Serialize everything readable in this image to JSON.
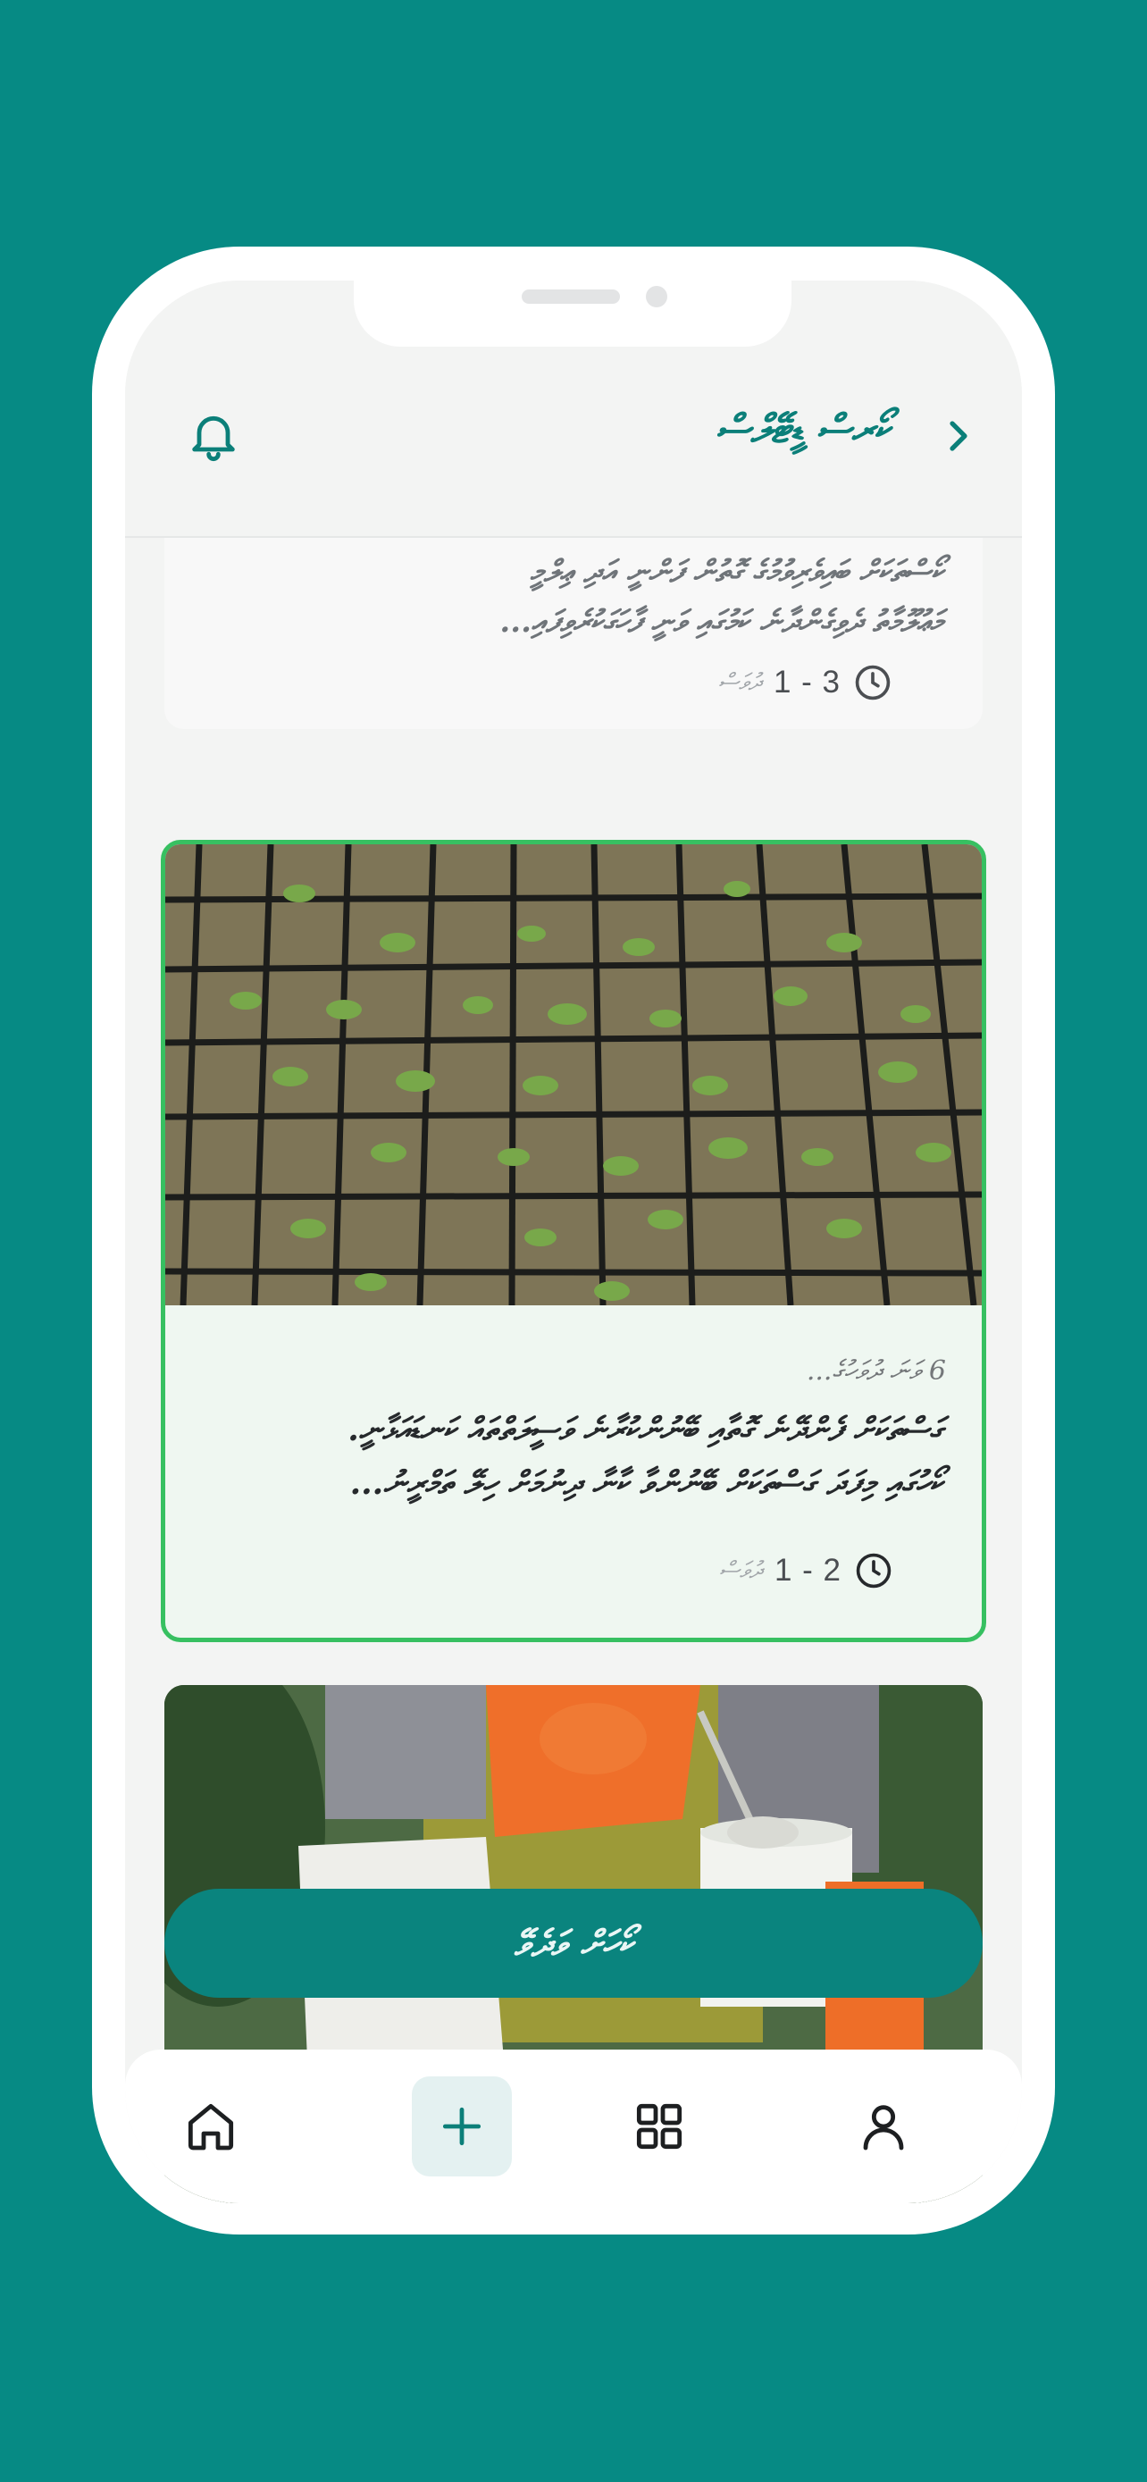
{
  "header": {
    "title": "ކޯރސް ޑީޓޭލްސް"
  },
  "cards": [
    {
      "text_lines": [
        "ކޯސްތަކަށް ބައިވެރިވުމުގެ ގޮތުން ފަންނީ އަދި ޢިލްމީ",
        "މަޢުލޫމާތު ދެވިގެންދާނެ ކަމުގައި ވަނީ ފާހަގަކުރެވިފައި..."
      ],
      "duration": "1 - 3",
      "duration_unit": "ދުވަސް",
      "highlighted": false
    },
    {
      "kicker": "6 ވަނަ ދުވަހުގެ...",
      "text_lines": [
        "ގަސްތަކަށް ފެންދޭނެ ގޮތާއި ބޭނުންކުރާނެ ވަސީލަތްތައް ކަނޑައަޅާނީ.",
        "ކޯހުގައި މިފަދަ ގަސްތަކަށް ބޭނުންވާ ކާނާ ދިނުމަށް ހިލޭ ތަމްރީނު..."
      ],
      "duration": "1 - 2",
      "duration_unit": "ދުވަސް",
      "highlighted": true
    },
    {
      "highlighted": false
    }
  ],
  "cta": {
    "label": "ކޯހަށް ވަދެވޭ"
  },
  "tabbar": {
    "items": [
      {
        "name": "home",
        "icon": "home-icon"
      },
      {
        "name": "add",
        "icon": "plus-icon",
        "active": true
      },
      {
        "name": "grid",
        "icon": "grid-icon"
      },
      {
        "name": "profile",
        "icon": "user-icon"
      }
    ]
  },
  "colors": {
    "background": "#068a84",
    "accent": "#0a847e",
    "highlight_border": "#37c061"
  }
}
